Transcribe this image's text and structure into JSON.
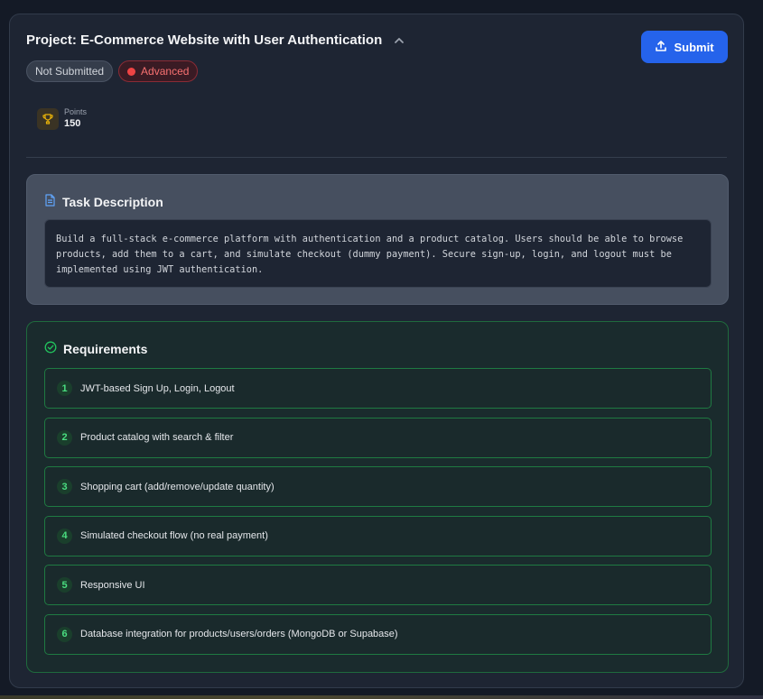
{
  "project": {
    "title": "Project: E-Commerce Website with User Authentication",
    "status_badge": "Not Submitted",
    "difficulty_badge": "Advanced",
    "submit_label": "Submit"
  },
  "points": {
    "label": "Points",
    "value": "150"
  },
  "task": {
    "heading": "Task Description",
    "description": "Build a full-stack e-commerce platform with authentication and a product catalog. Users should be able to browse products, add them to a cart, and simulate checkout (dummy payment). Secure sign-up, login, and logout must be implemented using JWT authentication."
  },
  "requirements": {
    "heading": "Requirements",
    "items": [
      {
        "num": "1",
        "text": "JWT-based Sign Up, Login, Logout"
      },
      {
        "num": "2",
        "text": "Product catalog with search & filter"
      },
      {
        "num": "3",
        "text": "Shopping cart (add/remove/update quantity)"
      },
      {
        "num": "4",
        "text": "Simulated checkout flow (no real payment)"
      },
      {
        "num": "5",
        "text": "Responsive UI"
      },
      {
        "num": "6",
        "text": "Database integration for products/users/orders (MongoDB or Supabase)"
      }
    ]
  },
  "colors": {
    "accent": "#2563eb",
    "success": "#22c55e",
    "danger": "#ef4444",
    "trophy": "#eab308"
  },
  "icons": {
    "collapse": "chevron-up-icon",
    "submit": "upload-icon",
    "points": "trophy-icon",
    "task": "document-icon",
    "requirements": "check-circle-icon"
  }
}
